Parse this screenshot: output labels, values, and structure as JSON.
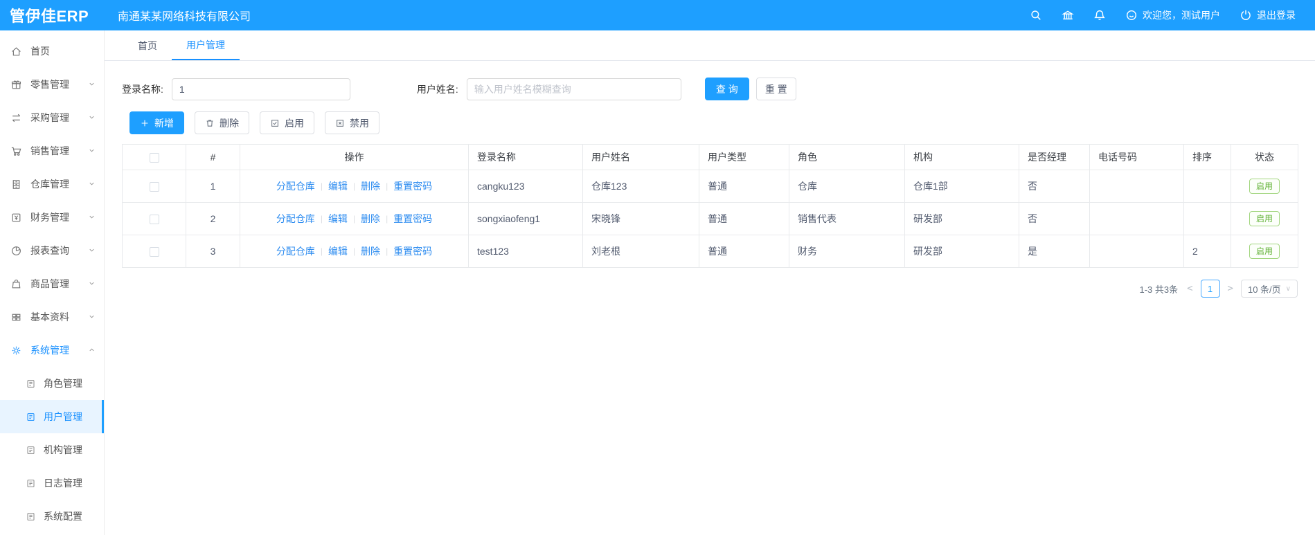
{
  "colors": {
    "header_bg": "#1e9fff",
    "accent": "#1890ff",
    "link": "#2d8cf0",
    "status_green": "#61b236"
  },
  "header": {
    "logo": "管伊佳ERP",
    "company": "南通某某网络科技有限公司",
    "icons": [
      "search-icon",
      "bank-icon",
      "bell-icon"
    ],
    "welcome": "欢迎您，测试用户",
    "logout": "退出登录"
  },
  "sidebar": {
    "items": [
      {
        "label": "首页",
        "icon": "home-icon"
      },
      {
        "label": "零售管理",
        "icon": "gift-icon"
      },
      {
        "label": "采购管理",
        "icon": "swap-icon"
      },
      {
        "label": "销售管理",
        "icon": "cart-icon"
      },
      {
        "label": "仓库管理",
        "icon": "cabinet-icon"
      },
      {
        "label": "财务管理",
        "icon": "finance-icon"
      },
      {
        "label": "报表查询",
        "icon": "pie-chart-icon"
      },
      {
        "label": "商品管理",
        "icon": "bag-icon"
      },
      {
        "label": "基本资料",
        "icon": "grid-icon"
      },
      {
        "label": "系统管理",
        "icon": "gear-icon"
      }
    ],
    "subitems": [
      {
        "label": "角色管理",
        "icon": "document-icon"
      },
      {
        "label": "用户管理",
        "icon": "document-icon"
      },
      {
        "label": "机构管理",
        "icon": "document-icon"
      },
      {
        "label": "日志管理",
        "icon": "document-icon"
      },
      {
        "label": "系统配置",
        "icon": "document-icon"
      }
    ]
  },
  "tabs": [
    {
      "label": "首页"
    },
    {
      "label": "用户管理"
    }
  ],
  "filter": {
    "login_label": "登录名称:",
    "login_value": "1",
    "name_label": "用户姓名:",
    "name_placeholder": "输入用户姓名模糊查询",
    "search_label": "查 询",
    "reset_label": "重 置"
  },
  "toolbar": {
    "add_label": "新增",
    "delete_label": "删除",
    "enable_label": "启用",
    "disable_label": "禁用"
  },
  "table": {
    "columns": [
      "",
      "#",
      "操作",
      "登录名称",
      "用户姓名",
      "用户类型",
      "角色",
      "机构",
      "是否经理",
      "电话号码",
      "排序",
      "状态"
    ],
    "actions": [
      "分配仓库",
      "编辑",
      "删除",
      "重置密码"
    ],
    "rows": [
      {
        "index": "1",
        "login": "cangku123",
        "name": "仓库123",
        "type": "普通",
        "role": "仓库",
        "org": "仓库1部",
        "manager": "否",
        "phone": "",
        "sort": "",
        "status": "启用"
      },
      {
        "index": "2",
        "login": "songxiaofeng1",
        "name": "宋晓锋",
        "type": "普通",
        "role": "销售代表",
        "org": "研发部",
        "manager": "否",
        "phone": "",
        "sort": "",
        "status": "启用"
      },
      {
        "index": "3",
        "login": "test123",
        "name": "刘老根",
        "type": "普通",
        "role": "财务",
        "org": "研发部",
        "manager": "是",
        "phone": "",
        "sort": "2",
        "status": "启用"
      }
    ]
  },
  "pagination": {
    "total": "1-3 共3条",
    "prev": "<",
    "page": "1",
    "next": ">",
    "page_size": "10 条/页",
    "caret": "∨"
  }
}
